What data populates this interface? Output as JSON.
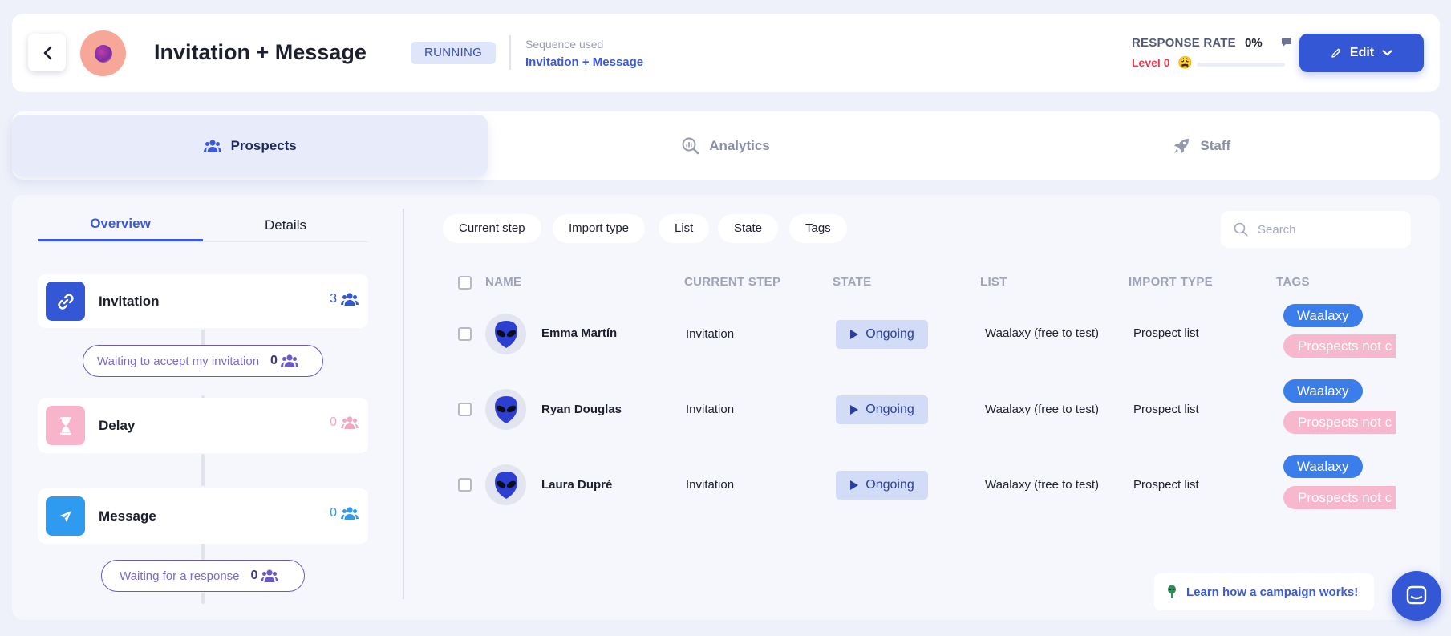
{
  "header": {
    "title": "Invitation + Message",
    "status": "RUNNING",
    "sequence_label": "Sequence used",
    "sequence_value": "Invitation + Message",
    "response_rate_label": "RESPONSE RATE",
    "response_rate_value": "0%",
    "level_label": "Level 0",
    "level_emoji": "😩",
    "level_progress": 0,
    "edit_label": "Edit"
  },
  "tabs": [
    {
      "label": "Prospects",
      "icon": "users-icon",
      "active": true
    },
    {
      "label": "Analytics",
      "icon": "analytics-icon",
      "active": false
    },
    {
      "label": "Staff",
      "icon": "rocket-icon",
      "active": false
    }
  ],
  "overview": {
    "tabs": [
      "Overview",
      "Details"
    ],
    "steps": [
      {
        "label": "Invitation",
        "count": "3",
        "icon": "link-icon",
        "color": "#3457d5"
      },
      {
        "label": "Delay",
        "count": "0",
        "icon": "hourglass-icon",
        "color": "#f7b4cb"
      },
      {
        "label": "Message",
        "count": "0",
        "icon": "send-icon",
        "color": "#2e9af0"
      }
    ],
    "waits": [
      {
        "label": "Waiting to accept my invitation",
        "count": "0"
      },
      {
        "label": "Waiting for a response",
        "count": "0"
      }
    ]
  },
  "filters": [
    "Current step",
    "Import type",
    "List",
    "State",
    "Tags"
  ],
  "search": {
    "placeholder": "Search",
    "value": ""
  },
  "table": {
    "columns": [
      "NAME",
      "CURRENT STEP",
      "STATE",
      "LIST",
      "IMPORT TYPE",
      "TAGS"
    ],
    "rows": [
      {
        "name": "Emma Martín",
        "step": "Invitation",
        "state": "Ongoing",
        "list": "Waalaxy (free to test)",
        "import_type": "Prospect list",
        "tags": [
          "Waalaxy",
          "Prospects not c"
        ]
      },
      {
        "name": "Ryan Douglas",
        "step": "Invitation",
        "state": "Ongoing",
        "list": "Waalaxy (free to test)",
        "import_type": "Prospect list",
        "tags": [
          "Waalaxy",
          "Prospects not c"
        ]
      },
      {
        "name": "Laura Dupré",
        "step": "Invitation",
        "state": "Ongoing",
        "list": "Waalaxy (free to test)",
        "import_type": "Prospect list",
        "tags": [
          "Waalaxy",
          "Prospects not c"
        ]
      }
    ]
  },
  "help": {
    "learn_label": "Learn how a campaign works!"
  },
  "colors": {
    "accent": "#3457d5",
    "danger": "#e43b4f",
    "tag_blue": "#3b7dea",
    "tag_pink": "#f7b7cd"
  }
}
